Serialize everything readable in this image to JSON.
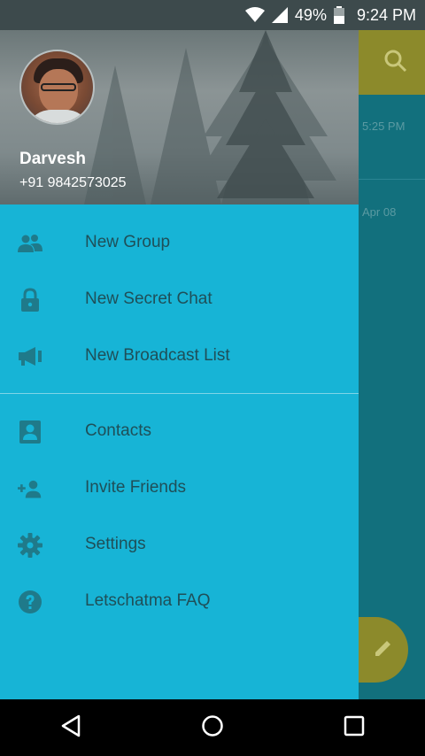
{
  "status_bar": {
    "battery_percent": "49%",
    "time": "9:24 PM",
    "icons": [
      "wifi-icon",
      "signal-icon",
      "battery-icon"
    ]
  },
  "background": {
    "rows": [
      {
        "time": "5:25 PM"
      },
      {
        "time": "Apr 08"
      }
    ]
  },
  "drawer": {
    "user": {
      "name": "Darvesh",
      "phone": "+91 9842573025"
    },
    "menu_primary": [
      {
        "label": "New Group",
        "icon": "group-icon"
      },
      {
        "label": "New Secret Chat",
        "icon": "lock-icon"
      },
      {
        "label": "New Broadcast List",
        "icon": "broadcast-icon"
      }
    ],
    "menu_secondary": [
      {
        "label": "Contacts",
        "icon": "contacts-icon"
      },
      {
        "label": "Invite Friends",
        "icon": "add-person-icon"
      },
      {
        "label": "Settings",
        "icon": "gear-icon"
      },
      {
        "label": "Letschatma FAQ",
        "icon": "help-icon"
      }
    ]
  },
  "colors": {
    "drawer_bg": "#17b4d6",
    "icon_color": "#1f7a8a",
    "label_color": "#1f4f58",
    "accent": "#8c8a2b"
  }
}
